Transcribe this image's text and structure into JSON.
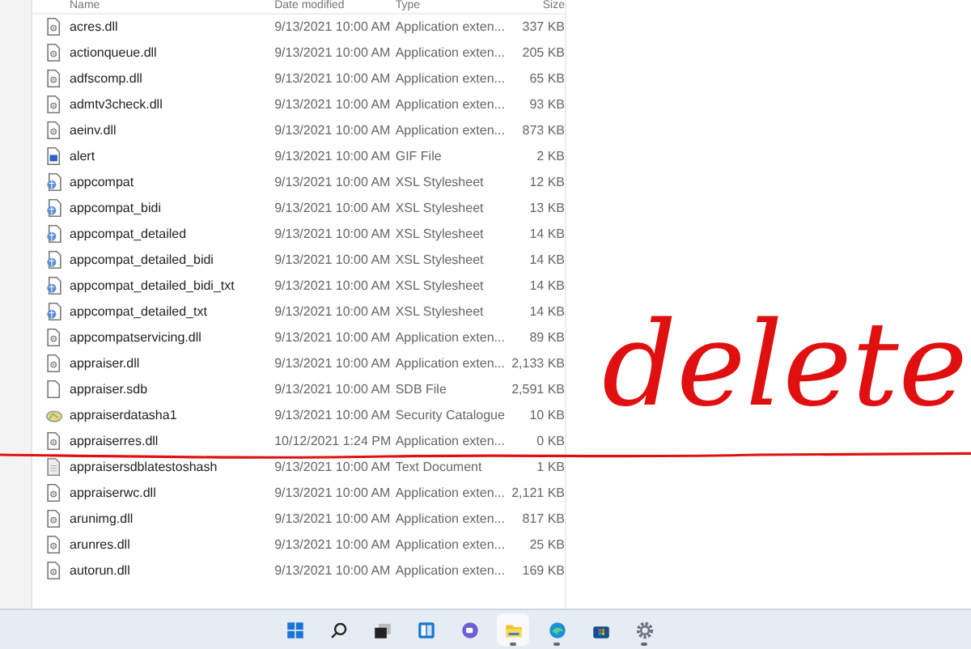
{
  "file_list": {
    "columns": [
      "Name",
      "Date modified",
      "Type",
      "Size"
    ],
    "rows": [
      {
        "kind": "dll",
        "name": "acres.dll",
        "date": "9/13/2021 10:00 AM",
        "type": "Application exten...",
        "size": "337 KB"
      },
      {
        "kind": "dll",
        "name": "actionqueue.dll",
        "date": "9/13/2021 10:00 AM",
        "type": "Application exten...",
        "size": "205 KB"
      },
      {
        "kind": "dll",
        "name": "adfscomp.dll",
        "date": "9/13/2021 10:00 AM",
        "type": "Application exten...",
        "size": "65 KB"
      },
      {
        "kind": "dll",
        "name": "admtv3check.dll",
        "date": "9/13/2021 10:00 AM",
        "type": "Application exten...",
        "size": "93 KB"
      },
      {
        "kind": "dll",
        "name": "aeinv.dll",
        "date": "9/13/2021 10:00 AM",
        "type": "Application exten...",
        "size": "873 KB"
      },
      {
        "kind": "image",
        "name": "alert",
        "date": "9/13/2021 10:00 AM",
        "type": "GIF File",
        "size": "2 KB"
      },
      {
        "kind": "stylesheet",
        "name": "appcompat",
        "date": "9/13/2021 10:00 AM",
        "type": "XSL Stylesheet",
        "size": "12 KB"
      },
      {
        "kind": "stylesheet",
        "name": "appcompat_bidi",
        "date": "9/13/2021 10:00 AM",
        "type": "XSL Stylesheet",
        "size": "13 KB"
      },
      {
        "kind": "stylesheet",
        "name": "appcompat_detailed",
        "date": "9/13/2021 10:00 AM",
        "type": "XSL Stylesheet",
        "size": "14 KB"
      },
      {
        "kind": "stylesheet",
        "name": "appcompat_detailed_bidi",
        "date": "9/13/2021 10:00 AM",
        "type": "XSL Stylesheet",
        "size": "14 KB"
      },
      {
        "kind": "stylesheet",
        "name": "appcompat_detailed_bidi_txt",
        "date": "9/13/2021 10:00 AM",
        "type": "XSL Stylesheet",
        "size": "14 KB"
      },
      {
        "kind": "stylesheet",
        "name": "appcompat_detailed_txt",
        "date": "9/13/2021 10:00 AM",
        "type": "XSL Stylesheet",
        "size": "14 KB"
      },
      {
        "kind": "dll",
        "name": "appcompatservicing.dll",
        "date": "9/13/2021 10:00 AM",
        "type": "Application exten...",
        "size": "89 KB"
      },
      {
        "kind": "dll",
        "name": "appraiser.dll",
        "date": "9/13/2021 10:00 AM",
        "type": "Application exten...",
        "size": "2,133 KB"
      },
      {
        "kind": "blank",
        "name": "appraiser.sdb",
        "date": "9/13/2021 10:00 AM",
        "type": "SDB File",
        "size": "2,591 KB"
      },
      {
        "kind": "catalog",
        "name": "appraiserdatasha1",
        "date": "9/13/2021 10:00 AM",
        "type": "Security Catalogue",
        "size": "10 KB"
      },
      {
        "kind": "dll",
        "name": "appraiserres.dll",
        "date": "10/12/2021 1:24 PM",
        "type": "Application exten...",
        "size": "0 KB"
      },
      {
        "kind": "text",
        "name": "appraisersdblatestoshash",
        "date": "9/13/2021 10:00 AM",
        "type": "Text Document",
        "size": "1 KB"
      },
      {
        "kind": "dll",
        "name": "appraiserwc.dll",
        "date": "9/13/2021 10:00 AM",
        "type": "Application exten...",
        "size": "2,121 KB"
      },
      {
        "kind": "dll",
        "name": "arunimg.dll",
        "date": "9/13/2021 10:00 AM",
        "type": "Application exten...",
        "size": "817 KB"
      },
      {
        "kind": "dll",
        "name": "arunres.dll",
        "date": "9/13/2021 10:00 AM",
        "type": "Application exten...",
        "size": "25 KB"
      },
      {
        "kind": "dll",
        "name": "autorun.dll",
        "date": "9/13/2021 10:00 AM",
        "type": "Application exten...",
        "size": "169 KB"
      }
    ]
  },
  "annotation": {
    "text": "delete"
  },
  "taskbar": [
    {
      "kind": "start",
      "selected": false,
      "running": false
    },
    {
      "kind": "search",
      "selected": false,
      "running": false
    },
    {
      "kind": "taskview",
      "selected": false,
      "running": false
    },
    {
      "kind": "widgets",
      "selected": false,
      "running": false
    },
    {
      "kind": "chat",
      "selected": false,
      "running": false
    },
    {
      "kind": "explorer",
      "selected": true,
      "running": true
    },
    {
      "kind": "browser",
      "selected": false,
      "running": true
    },
    {
      "kind": "store",
      "selected": false,
      "running": false
    },
    {
      "kind": "settings",
      "selected": false,
      "running": true
    }
  ]
}
